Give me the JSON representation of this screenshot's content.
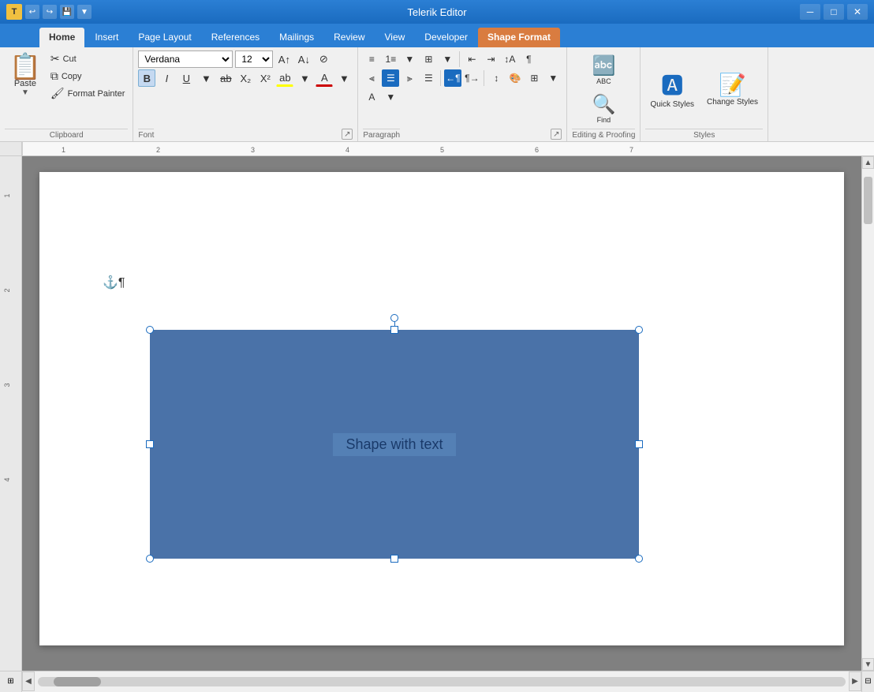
{
  "titleBar": {
    "title": "Telerik Editor",
    "icon": "T"
  },
  "tabs": [
    {
      "label": "Home",
      "active": true,
      "shapeFormat": false
    },
    {
      "label": "Insert",
      "active": false,
      "shapeFormat": false
    },
    {
      "label": "Page Layout",
      "active": false,
      "shapeFormat": false
    },
    {
      "label": "References",
      "active": false,
      "shapeFormat": false
    },
    {
      "label": "Mailings",
      "active": false,
      "shapeFormat": false
    },
    {
      "label": "Review",
      "active": false,
      "shapeFormat": false
    },
    {
      "label": "View",
      "active": false,
      "shapeFormat": false
    },
    {
      "label": "Developer",
      "active": false,
      "shapeFormat": false
    },
    {
      "label": "Shape Format",
      "active": false,
      "shapeFormat": true
    }
  ],
  "clipboard": {
    "groupLabel": "Clipboard",
    "pasteLabel": "Paste",
    "cutLabel": "Cut",
    "copyLabel": "Copy",
    "formatPainterLabel": "Format Painter"
  },
  "font": {
    "groupLabel": "Font",
    "fontName": "Verdana",
    "fontSize": "12",
    "boldLabel": "B",
    "italicLabel": "I",
    "underlineLabel": "U"
  },
  "paragraph": {
    "groupLabel": "Paragraph"
  },
  "editingProofing": {
    "groupLabel": "Editing & Proofing"
  },
  "styles": {
    "groupLabel": "Styles",
    "quickStylesLabel": "Quick Styles",
    "changeStylesLabel": "Change Styles"
  },
  "document": {
    "shapeText": "Shape with text",
    "anchorSymbol": "⚓¶"
  },
  "colors": {
    "shapeBackground": "#4a72a8",
    "activeTabBg": "#f0f0f0",
    "shapeFormatTab": "#d97c40",
    "accent": "#1a6bbf",
    "titleBar": "#2b7fd4"
  }
}
